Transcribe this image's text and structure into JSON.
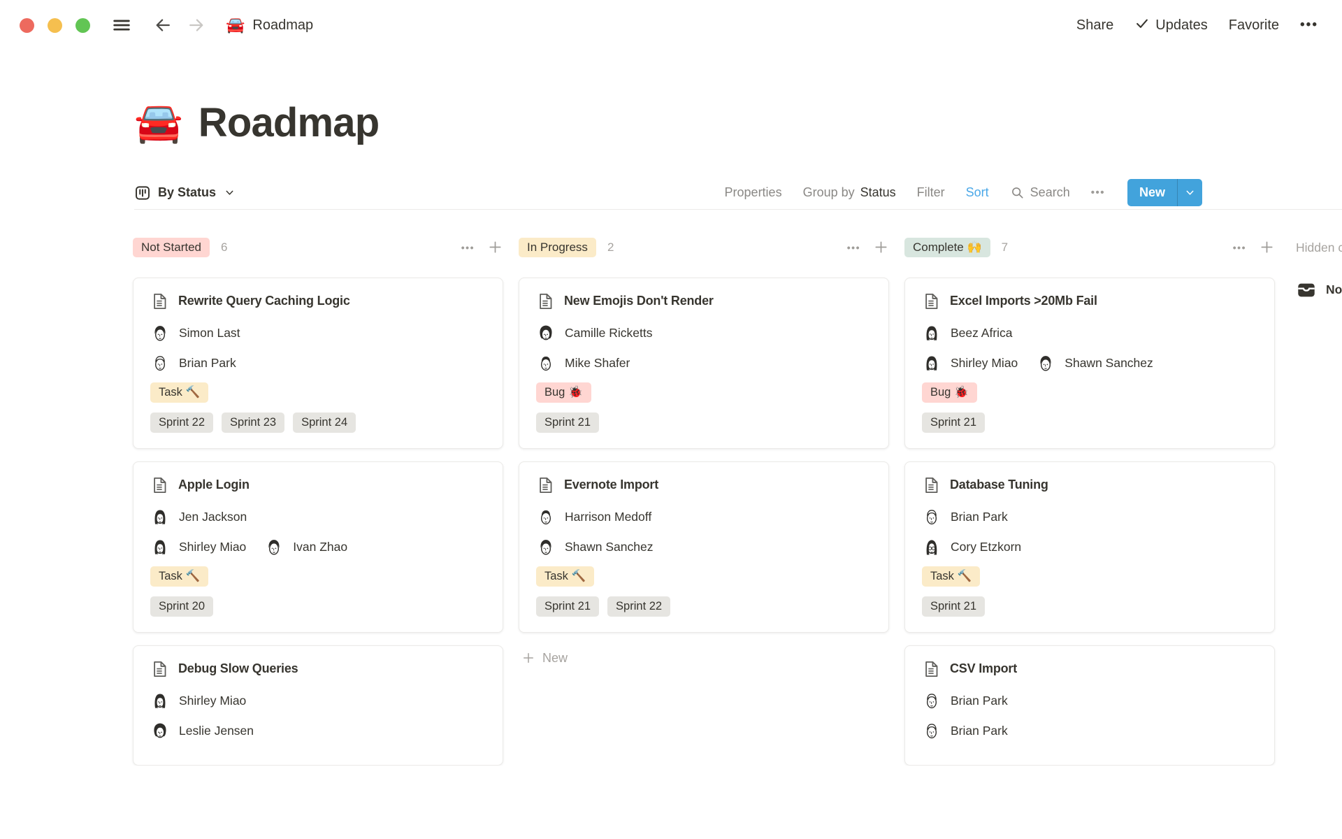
{
  "window": {
    "doc_emoji": "🚘",
    "doc_title": "Roadmap",
    "share": "Share",
    "updates": "Updates",
    "favorite": "Favorite",
    "more": "•••"
  },
  "page": {
    "emoji": "🚘",
    "title": "Roadmap"
  },
  "toolbar": {
    "view_label": "By Status",
    "properties": "Properties",
    "group_by": "Group by",
    "group_by_value": "Status",
    "filter": "Filter",
    "sort": "Sort",
    "search": "Search",
    "more": "•••",
    "new": "New",
    "accent": "#42A3DC",
    "sort_color": "#4BA8E8"
  },
  "board": {
    "icons": {
      "more": "•••"
    },
    "new_card_label": "New",
    "hidden_label": "Hidden columns",
    "hidden_items": [
      {
        "icon": "inbox-icon",
        "label": "No Status"
      }
    ],
    "tag_colors": {
      "red": "#FFD6D2",
      "yellow": "#FBEBC8",
      "green": "#D8E6DF",
      "gray": "#E6E5E1"
    },
    "columns": [
      {
        "name": "Not Started",
        "emoji": "",
        "color": "red",
        "count": 6,
        "show_new": false,
        "cards": [
          {
            "title": "Rewrite Query Caching Logic",
            "people": [
              [
                {
                  "name": "Simon Last",
                  "avatar": "man-dark"
                }
              ],
              [
                {
                  "name": "Brian Park",
                  "avatar": "man-light"
                }
              ]
            ],
            "tags": [
              {
                "label": "Task 🔨",
                "color": "yellow"
              }
            ],
            "sprints": [
              "Sprint 22",
              "Sprint 23",
              "Sprint 24"
            ]
          },
          {
            "title": "Apple Login",
            "people": [
              [
                {
                  "name": "Jen Jackson",
                  "avatar": "woman-bob"
                }
              ],
              [
                {
                  "name": "Shirley Miao",
                  "avatar": "woman-bob"
                },
                {
                  "name": "Ivan Zhao",
                  "avatar": "man-dark"
                }
              ]
            ],
            "tags": [
              {
                "label": "Task 🔨",
                "color": "yellow"
              }
            ],
            "sprints": [
              "Sprint 20"
            ]
          },
          {
            "title": "Debug Slow Queries",
            "people": [
              [
                {
                  "name": "Shirley Miao",
                  "avatar": "woman-bob"
                }
              ],
              [
                {
                  "name": "Leslie Jensen",
                  "avatar": "woman-curly"
                }
              ]
            ],
            "tags": [],
            "sprints": []
          }
        ]
      },
      {
        "name": "In Progress",
        "emoji": "",
        "color": "yellow",
        "count": 2,
        "show_new": true,
        "cards": [
          {
            "title": "New Emojis Don't Render",
            "people": [
              [
                {
                  "name": "Camille Ricketts",
                  "avatar": "woman-curly"
                }
              ],
              [
                {
                  "name": "Mike Shafer",
                  "avatar": "man-short"
                }
              ]
            ],
            "tags": [
              {
                "label": "Bug 🐞",
                "color": "red"
              }
            ],
            "sprints": [
              "Sprint 21"
            ]
          },
          {
            "title": "Evernote Import",
            "people": [
              [
                {
                  "name": "Harrison Medoff",
                  "avatar": "man-short"
                }
              ],
              [
                {
                  "name": "Shawn Sanchez",
                  "avatar": "man-dark"
                }
              ]
            ],
            "tags": [
              {
                "label": "Task 🔨",
                "color": "yellow"
              }
            ],
            "sprints": [
              "Sprint 21",
              "Sprint 22"
            ]
          }
        ]
      },
      {
        "name": "Complete",
        "emoji": "🙌",
        "color": "green",
        "count": 7,
        "show_new": false,
        "cards": [
          {
            "title": "Excel Imports >20Mb Fail",
            "people": [
              [
                {
                  "name": "Beez Africa",
                  "avatar": "woman-bob"
                }
              ],
              [
                {
                  "name": "Shirley Miao",
                  "avatar": "woman-bob"
                },
                {
                  "name": "Shawn Sanchez",
                  "avatar": "man-dark"
                }
              ]
            ],
            "tags": [
              {
                "label": "Bug 🐞",
                "color": "red"
              }
            ],
            "sprints": [
              "Sprint 21"
            ]
          },
          {
            "title": "Database Tuning",
            "people": [
              [
                {
                  "name": "Brian Park",
                  "avatar": "man-light"
                }
              ],
              [
                {
                  "name": "Cory Etzkorn",
                  "avatar": "person-glasses"
                }
              ]
            ],
            "tags": [
              {
                "label": "Task 🔨",
                "color": "yellow"
              }
            ],
            "sprints": [
              "Sprint 21"
            ]
          },
          {
            "title": "CSV Import",
            "people": [
              [
                {
                  "name": "Brian Park",
                  "avatar": "man-light"
                }
              ],
              [
                {
                  "name": "Brian Park",
                  "avatar": "man-light"
                }
              ]
            ],
            "tags": [],
            "sprints": []
          }
        ]
      }
    ]
  }
}
